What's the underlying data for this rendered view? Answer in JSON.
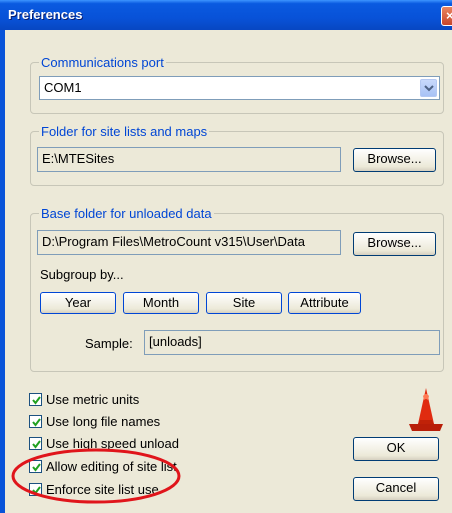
{
  "window": {
    "title": "Preferences"
  },
  "comm": {
    "legend": "Communications port",
    "port": "COM1"
  },
  "folder": {
    "legend": "Folder for site lists and maps",
    "path": "E:\\MTESites",
    "browse": "Browse..."
  },
  "base": {
    "legend": "Base folder for unloaded data",
    "path": "D:\\Program Files\\MetroCount v315\\User\\Data",
    "browse": "Browse...",
    "subgroup_label": "Subgroup by...",
    "buttons": [
      "Year",
      "Month",
      "Site",
      "Attribute"
    ],
    "sample_label": "Sample:",
    "sample_value": "[unloads]"
  },
  "options": [
    {
      "label": "Use metric units",
      "checked": true
    },
    {
      "label": "Use long file names",
      "checked": true
    },
    {
      "label": "Use high speed unload",
      "checked": true
    },
    {
      "label": "Allow editing of site list",
      "checked": true
    },
    {
      "label": "Enforce site list use",
      "checked": true
    }
  ],
  "actions": {
    "ok": "OK",
    "cancel": "Cancel"
  },
  "colors": {
    "titlebar": "#0852d8",
    "legend_text": "#0046d5",
    "highlight_ellipse": "#e0151b",
    "cone": "#e02b10"
  }
}
